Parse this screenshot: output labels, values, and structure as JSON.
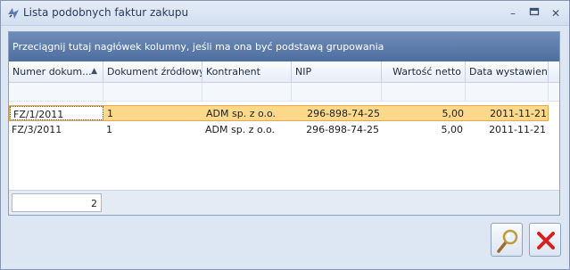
{
  "window": {
    "title": "Lista podobnych faktur zakupu"
  },
  "grid": {
    "group_hint": "Przeciągnij tutaj nagłówek kolumny, jeśli ma ona być podstawą grupowania",
    "columns": [
      "Numer dokum...",
      "Dokument źródłowy",
      "Kontrahent",
      "NIP",
      "Wartość netto",
      "Data wystawienia"
    ],
    "rows": [
      [
        "FZ/1/2011",
        "1",
        "ADM sp. z o.o.",
        "296-898-74-25",
        "5,00",
        "2011-11-21"
      ],
      [
        "FZ/3/2011",
        "1",
        "ADM sp. z o.o.",
        "296-898-74-25",
        "5,00",
        "2011-11-21"
      ]
    ],
    "record_count": "2",
    "sorted_column": "Numer dokum...",
    "sort_direction": "ascending"
  },
  "buttons": {
    "search_icon": "magnifier-icon",
    "close_icon": "red-x-icon"
  },
  "colors": {
    "group_panel": "#5b7aab",
    "selected_row": "#fcd98a",
    "window_bg": "#dde6f3",
    "close_x": "#d42020"
  }
}
